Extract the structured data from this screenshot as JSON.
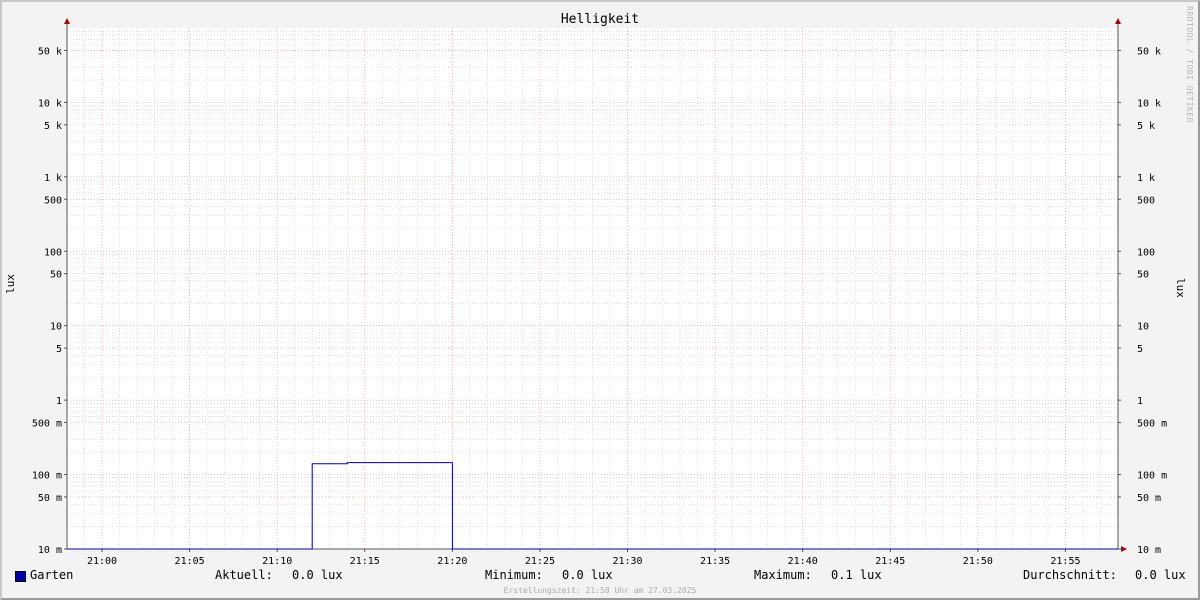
{
  "chart_data": {
    "type": "line",
    "title": "Helligkeit",
    "ylabel": "lux",
    "yscale": "log",
    "ylim": [
      0.01,
      100000
    ],
    "xlim": [
      "20:58",
      "21:58"
    ],
    "x_ticks": [
      "21:00",
      "21:05",
      "21:10",
      "21:15",
      "21:20",
      "21:25",
      "21:30",
      "21:35",
      "21:40",
      "21:45",
      "21:50",
      "21:55"
    ],
    "y_ticks": [
      {
        "value": 50000,
        "label": "50 k"
      },
      {
        "value": 10000,
        "label": "10 k"
      },
      {
        "value": 5000,
        "label": "5 k"
      },
      {
        "value": 1000,
        "label": "1 k"
      },
      {
        "value": 500,
        "label": "500"
      },
      {
        "value": 100,
        "label": "100"
      },
      {
        "value": 50,
        "label": "50"
      },
      {
        "value": 10,
        "label": "10"
      },
      {
        "value": 5,
        "label": "5"
      },
      {
        "value": 1,
        "label": "1"
      },
      {
        "value": 0.5,
        "label": "500 m"
      },
      {
        "value": 0.1,
        "label": "100 m"
      },
      {
        "value": 0.05,
        "label": "50 m"
      },
      {
        "value": 0.01,
        "label": "10 m"
      }
    ],
    "grid": true,
    "legend_position": "bottom",
    "series": [
      {
        "name": "Garten",
        "color": "#0000a0",
        "points": [
          {
            "x": "20:58",
            "y": 0.01
          },
          {
            "x": "21:12",
            "y": 0.01
          },
          {
            "x": "21:12",
            "y": 0.14
          },
          {
            "x": "21:14",
            "y": 0.14
          },
          {
            "x": "21:14",
            "y": 0.145
          },
          {
            "x": "21:20",
            "y": 0.145
          },
          {
            "x": "21:20",
            "y": 0.01
          },
          {
            "x": "21:58",
            "y": 0.01
          }
        ]
      }
    ]
  },
  "legend": {
    "series_name": "Garten",
    "current_label": "Aktuell:",
    "current_value": "0.0 lux",
    "min_label": "Minimum:",
    "min_value": "0.0 lux",
    "max_label": "Maximum:",
    "max_value": "0.1 lux",
    "avg_label": "Durchschnitt:",
    "avg_value": "0.0 lux"
  },
  "footer": "Erstellungszeit: 21:58 Uhr am 27.03.2025",
  "watermark": "RRDTOOL / TOBI OETIKER",
  "colors": {
    "series": "#0000a0",
    "major_grid": "#e8a0a0",
    "minor_grid": "#c8c8c8",
    "axis_arrow": "#aa0000",
    "background": "#f3f3f3",
    "plot_background": "#ffffff"
  }
}
